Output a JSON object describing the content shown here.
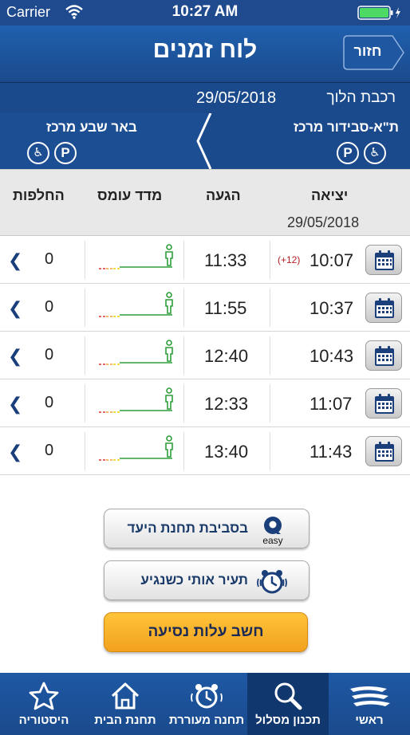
{
  "status_bar": {
    "carrier": "Carrier",
    "time": "10:27 AM"
  },
  "header": {
    "title": "לוח זמנים",
    "back_label": "חזור"
  },
  "train": {
    "type": "רכבת הלוך",
    "date": "29/05/2018"
  },
  "route": {
    "origin": "ת\"א-סבידור מרכז",
    "destination": "באר שבע מרכז",
    "parking_symbol": "P",
    "accessible_symbol": "♿"
  },
  "columns": {
    "departure": "יציאה",
    "arrival": "הגעה",
    "crowding": "מדד עומס",
    "changes": "החלפות",
    "date": "29/05/2018"
  },
  "trips": [
    {
      "departure": "10:07",
      "delay": "(+12)",
      "arrival": "11:33",
      "changes": "0"
    },
    {
      "departure": "10:37",
      "delay": "",
      "arrival": "11:55",
      "changes": "0"
    },
    {
      "departure": "10:43",
      "delay": "",
      "arrival": "12:40",
      "changes": "0"
    },
    {
      "departure": "11:07",
      "delay": "",
      "arrival": "12:33",
      "changes": "0"
    },
    {
      "departure": "11:43",
      "delay": "",
      "arrival": "13:40",
      "changes": "0"
    }
  ],
  "actions": {
    "nearby_label": "בסביבת תחנת היעד",
    "easy_word": "easy",
    "wake_label": "תעיר אותי כשנגיע",
    "fare_label": "חשב עלות נסיעה"
  },
  "tabs": [
    {
      "label": "ראשי",
      "icon": "train-logo-icon"
    },
    {
      "label": "תכנון מסלול",
      "icon": "search-icon"
    },
    {
      "label": "תחנה מעוררת",
      "icon": "alarm-clock-icon"
    },
    {
      "label": "תחנת הבית",
      "icon": "home-icon"
    },
    {
      "label": "היסטוריה",
      "icon": "star-icon"
    }
  ],
  "colors": {
    "primary": "#1a4a8c",
    "accent": "#f2a11e",
    "crowd_green": "#2e9e3a",
    "delay_red": "#b21f1f"
  }
}
